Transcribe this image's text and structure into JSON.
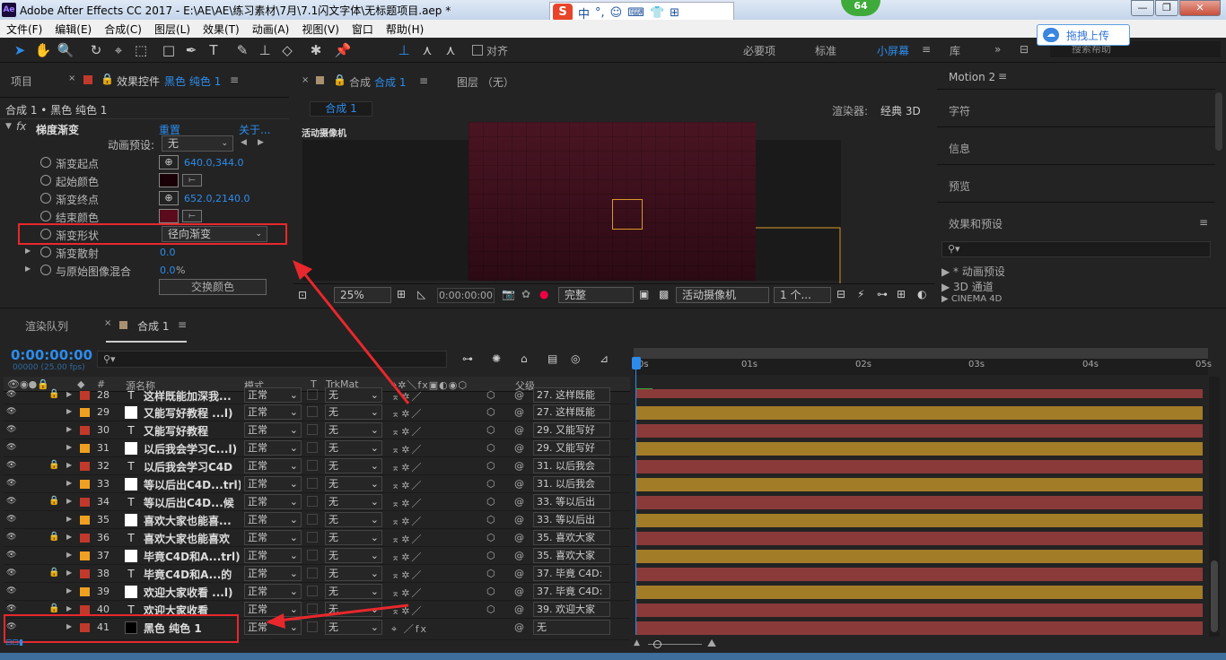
{
  "window": {
    "title": "Adobe After Effects CC 2017 - E:\\AE\\AE\\练习素材\\7月\\7.1闪文字体\\无标题项目.aep *",
    "icon": "Ae",
    "badge": "64"
  },
  "ime": {
    "logo": "S",
    "items": [
      "中",
      "°,",
      "☺",
      "⌨",
      "👕",
      "⊞"
    ]
  },
  "menu": [
    "文件(F)",
    "编辑(E)",
    "合成(C)",
    "图层(L)",
    "效果(T)",
    "动画(A)",
    "视图(V)",
    "窗口",
    "帮助(H)"
  ],
  "toolbar": {
    "snap_label": "对齐",
    "workspaces": [
      "必要项",
      "标准",
      "小屏幕",
      "库"
    ],
    "active_workspace": "小屏幕",
    "search_placeholder": "搜索帮助",
    "upload_label": "拖拽上传"
  },
  "effect_panel": {
    "tab_project": "项目",
    "tab_label": "效果控件",
    "tab_layer": "黑色 纯色 1",
    "layer_path": "合成 1 • 黑色 纯色 1",
    "effect_name": "梯度渐变",
    "reset": "重置",
    "about": "关于...",
    "preset_label": "动画预设:",
    "preset_value": "无",
    "props": [
      {
        "name": "渐变起点",
        "value": "640.0,344.0",
        "kind": "point"
      },
      {
        "name": "起始颜色",
        "color": "#190006",
        "kind": "color"
      },
      {
        "name": "渐变终点",
        "value": "652.0,2140.0",
        "kind": "point"
      },
      {
        "name": "结束颜色",
        "color": "#5c0b1c",
        "kind": "color"
      },
      {
        "name": "渐变形状",
        "value": "径向渐变",
        "kind": "dropdown"
      },
      {
        "name": "渐变散射",
        "value": "0.0",
        "kind": "value"
      },
      {
        "name": "与原始图像混合",
        "value": "0.0",
        "unit": "%",
        "kind": "value"
      }
    ],
    "swap_button": "交换颜色"
  },
  "comp_viewer": {
    "tab_label": "合成",
    "tab_name": "合成 1",
    "layer_tab": "图层 （无）",
    "subtab": "合成 1",
    "renderer_label": "渲染器:",
    "renderer_value": "经典 3D",
    "camera_label": "活动摄像机",
    "zoom": "25%",
    "timecode": "0:00:00:00",
    "quality": "完整",
    "camera_select": "活动摄像机",
    "views": "1 个..."
  },
  "right_panel": {
    "title": "Motion 2",
    "items": [
      "字符",
      "信息",
      "预览",
      "效果和预设"
    ],
    "tree": [
      "* 动画预设",
      "3D 通道",
      "CINEMA 4D"
    ]
  },
  "timeline": {
    "tab_render": "渲染队列",
    "tab_comp": "合成 1",
    "timecode": "0:00:00:00",
    "fps": "00000 (25.00 fps)",
    "headers": {
      "source": "源名称",
      "mode": "模式",
      "t": "T",
      "trkmat": "TrkMat",
      "parent": "父级",
      "num": "#"
    },
    "ruler": [
      "0s",
      "01s",
      "02s",
      "03s",
      "04s",
      "05s"
    ],
    "layers": [
      {
        "num": "28",
        "type": "T",
        "name": "这样既能加深我...",
        "mode": "正常",
        "trk": "无",
        "parent": "27. 这样既能",
        "lock": true,
        "color": "#c0392b",
        "bar": "#8b3a3a"
      },
      {
        "num": "29",
        "type": "solid",
        "name": "又能写好教程 ...l)",
        "mode": "正常",
        "trk": "无",
        "parent": "27. 这样既能",
        "lock": false,
        "color": "#f0a020",
        "bar": "#a37c28"
      },
      {
        "num": "30",
        "type": "T",
        "name": "又能写好教程",
        "mode": "正常",
        "trk": "无",
        "parent": "29. 又能写好",
        "lock": false,
        "color": "#c0392b",
        "bar": "#8b3a3a"
      },
      {
        "num": "31",
        "type": "solid",
        "name": "以后我会学习C...l)",
        "mode": "正常",
        "trk": "无",
        "parent": "29. 又能写好",
        "lock": false,
        "color": "#f0a020",
        "bar": "#a37c28"
      },
      {
        "num": "32",
        "type": "T",
        "name": "以后我会学习C4D",
        "mode": "正常",
        "trk": "无",
        "parent": "31. 以后我会",
        "lock": true,
        "color": "#c0392b",
        "bar": "#8b3a3a"
      },
      {
        "num": "33",
        "type": "solid",
        "name": "等以后出C4D...trl)",
        "mode": "正常",
        "trk": "无",
        "parent": "31. 以后我会",
        "lock": false,
        "color": "#f0a020",
        "bar": "#a37c28"
      },
      {
        "num": "34",
        "type": "T",
        "name": "等以后出C4D...候",
        "mode": "正常",
        "trk": "无",
        "parent": "33. 等以后出",
        "lock": true,
        "color": "#c0392b",
        "bar": "#8b3a3a"
      },
      {
        "num": "35",
        "type": "solid",
        "name": "喜欢大家也能喜...",
        "mode": "正常",
        "trk": "无",
        "parent": "33. 等以后出",
        "lock": false,
        "color": "#f0a020",
        "bar": "#a37c28"
      },
      {
        "num": "36",
        "type": "T",
        "name": "喜欢大家也能喜欢",
        "mode": "正常",
        "trk": "无",
        "parent": "35. 喜欢大家",
        "lock": true,
        "color": "#c0392b",
        "bar": "#8b3a3a"
      },
      {
        "num": "37",
        "type": "solid",
        "name": "毕竟C4D和A...trl)",
        "mode": "正常",
        "trk": "无",
        "parent": "35. 喜欢大家",
        "lock": false,
        "color": "#f0a020",
        "bar": "#a37c28"
      },
      {
        "num": "38",
        "type": "T",
        "name": "毕竟C4D和A...的",
        "mode": "正常",
        "trk": "无",
        "parent": "37. 毕竟 C4D:",
        "lock": true,
        "color": "#c0392b",
        "bar": "#8b3a3a"
      },
      {
        "num": "39",
        "type": "solid",
        "name": "欢迎大家收看 ...l)",
        "mode": "正常",
        "trk": "无",
        "parent": "37. 毕竟 C4D:",
        "lock": false,
        "color": "#f0a020",
        "bar": "#a37c28"
      },
      {
        "num": "40",
        "type": "T",
        "name": "欢迎大家收看",
        "mode": "正常",
        "trk": "无",
        "parent": "39. 欢迎大家",
        "lock": true,
        "color": "#c0392b",
        "bar": "#8b3a3a"
      },
      {
        "num": "41",
        "type": "black",
        "name": "黑色 纯色 1",
        "mode": "正常",
        "trk": "无",
        "parent": "无",
        "lock": false,
        "color": "#c0392b",
        "bar": "#8b3a3a"
      }
    ]
  },
  "colors": {
    "accent": "#2d8ceb",
    "highlight_box": "#e8282c",
    "arrow": "#e8282c"
  }
}
